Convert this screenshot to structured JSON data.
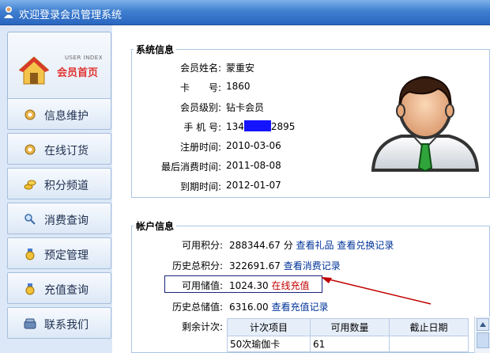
{
  "window": {
    "title": "欢迎登录会员管理系统"
  },
  "sidebar": {
    "home": {
      "subtitle": "USER INDEX",
      "label": "会员首页"
    },
    "items": [
      {
        "label": "信息维护"
      },
      {
        "label": "在线订货"
      },
      {
        "label": "积分频道"
      },
      {
        "label": "消费查询"
      },
      {
        "label": "预定管理"
      },
      {
        "label": "充值查询"
      },
      {
        "label": "联系我们"
      }
    ]
  },
  "system_info": {
    "title": "系统信息",
    "rows": [
      {
        "label": "会员姓名:",
        "value": "蒙重安"
      },
      {
        "label": "卡　　号:",
        "value": "1860"
      },
      {
        "label": "会员级别:",
        "value": "钻卡会员"
      },
      {
        "label": "手 机 号:",
        "value_prefix": "134",
        "value_suffix": "2895"
      },
      {
        "label": "注册时间:",
        "value": "2010-03-06"
      },
      {
        "label": "最后消费时间:",
        "value": "2011-08-08"
      },
      {
        "label": "到期时间:",
        "value": "2012-01-07"
      }
    ]
  },
  "account_info": {
    "title": "帐户信息",
    "points": {
      "label": "可用积分:",
      "value": "288344.67 分",
      "link1": "查看礼品",
      "link2": "查看兑换记录"
    },
    "total_points": {
      "label": "历史总积分:",
      "value": "322691.67",
      "link": "查看消费记录"
    },
    "balance": {
      "label": "可用储值:",
      "value": "1024.30",
      "link": "在线充值"
    },
    "total_balance": {
      "label": "历史总储值:",
      "value": "6316.00",
      "link": "查看充值记录"
    },
    "counts_label": "剩余计次:",
    "counts_table": {
      "headers": [
        "计次项目",
        "可用数量",
        "截止日期"
      ],
      "rows": [
        [
          "50次瑜伽卡",
          "61",
          ""
        ]
      ]
    }
  },
  "colors": {
    "titlebar": "#2a66c0",
    "highlight_border": "#1a237e",
    "arrow": "#c00000",
    "link_red": "#c00000"
  }
}
